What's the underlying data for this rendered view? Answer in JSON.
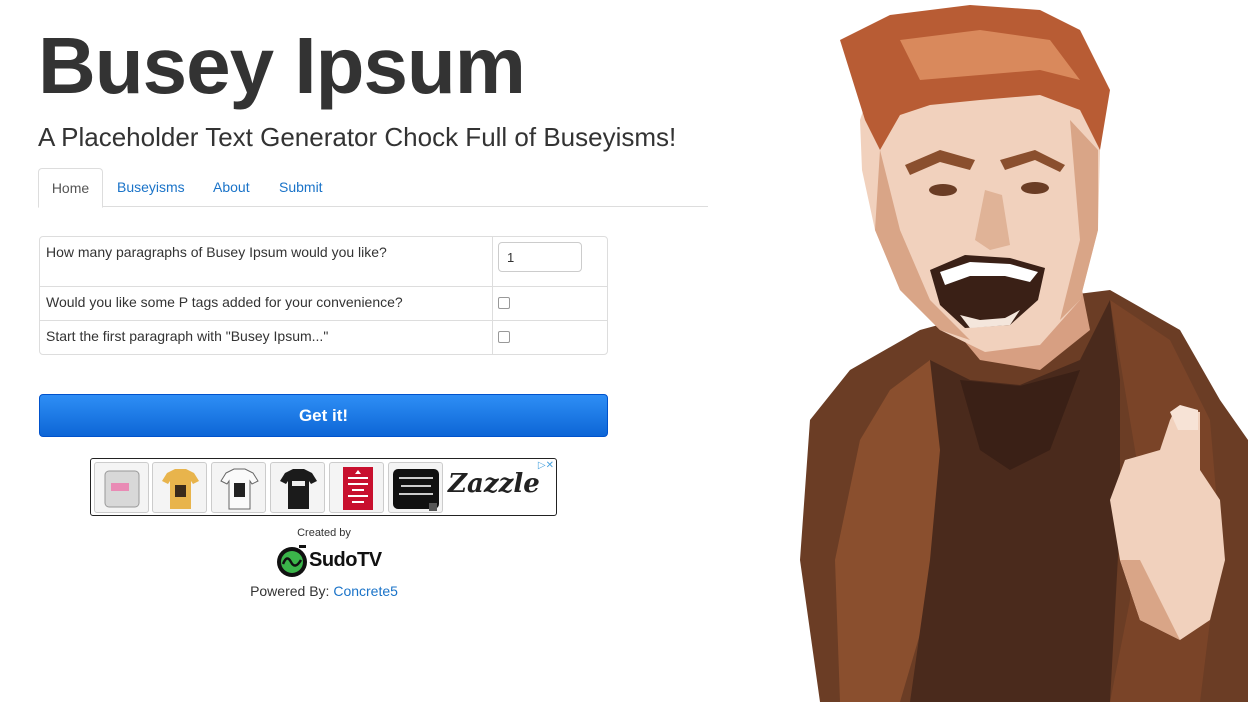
{
  "header": {
    "title": "Busey Ipsum",
    "subtitle": "A Placeholder Text Generator Chock Full of Buseyisms!"
  },
  "tabs": [
    {
      "label": "Home",
      "active": true
    },
    {
      "label": "Buseyisms",
      "active": false
    },
    {
      "label": "About",
      "active": false
    },
    {
      "label": "Submit",
      "active": false
    }
  ],
  "form": {
    "rows": [
      {
        "question": "How many paragraphs of Busey Ipsum would you like?",
        "control": "text-input",
        "value": "1"
      },
      {
        "question": "Would you like some P tags added for your convenience?",
        "control": "checkbox",
        "checked": false
      },
      {
        "question": "Start the first paragraph with \"Busey Ipsum...\"",
        "control": "checkbox",
        "checked": false
      }
    ],
    "submit_label": "Get it!"
  },
  "ad": {
    "brand": "Zazzle",
    "choices_icon": "ad-choices-icon",
    "thumbs": [
      {
        "name": "ad-thumb-case"
      },
      {
        "name": "ad-thumb-tshirt-yellow"
      },
      {
        "name": "ad-thumb-tshirt-white"
      },
      {
        "name": "ad-thumb-tshirt-black"
      },
      {
        "name": "ad-thumb-keep-calm",
        "text": "KEEP CALM AND LOVE ME"
      },
      {
        "name": "ad-thumb-your-image",
        "text": "Your Image or Text Here"
      }
    ]
  },
  "footer": {
    "created_by": "Created by",
    "creator_logo_text": "SudoTV",
    "powered_by_label": "Powered By:",
    "powered_by_link": "Concrete5"
  },
  "colors": {
    "link": "#1a73c8",
    "button_top": "#2e8ef5",
    "button_bottom": "#0d66d6",
    "text": "#333333"
  }
}
